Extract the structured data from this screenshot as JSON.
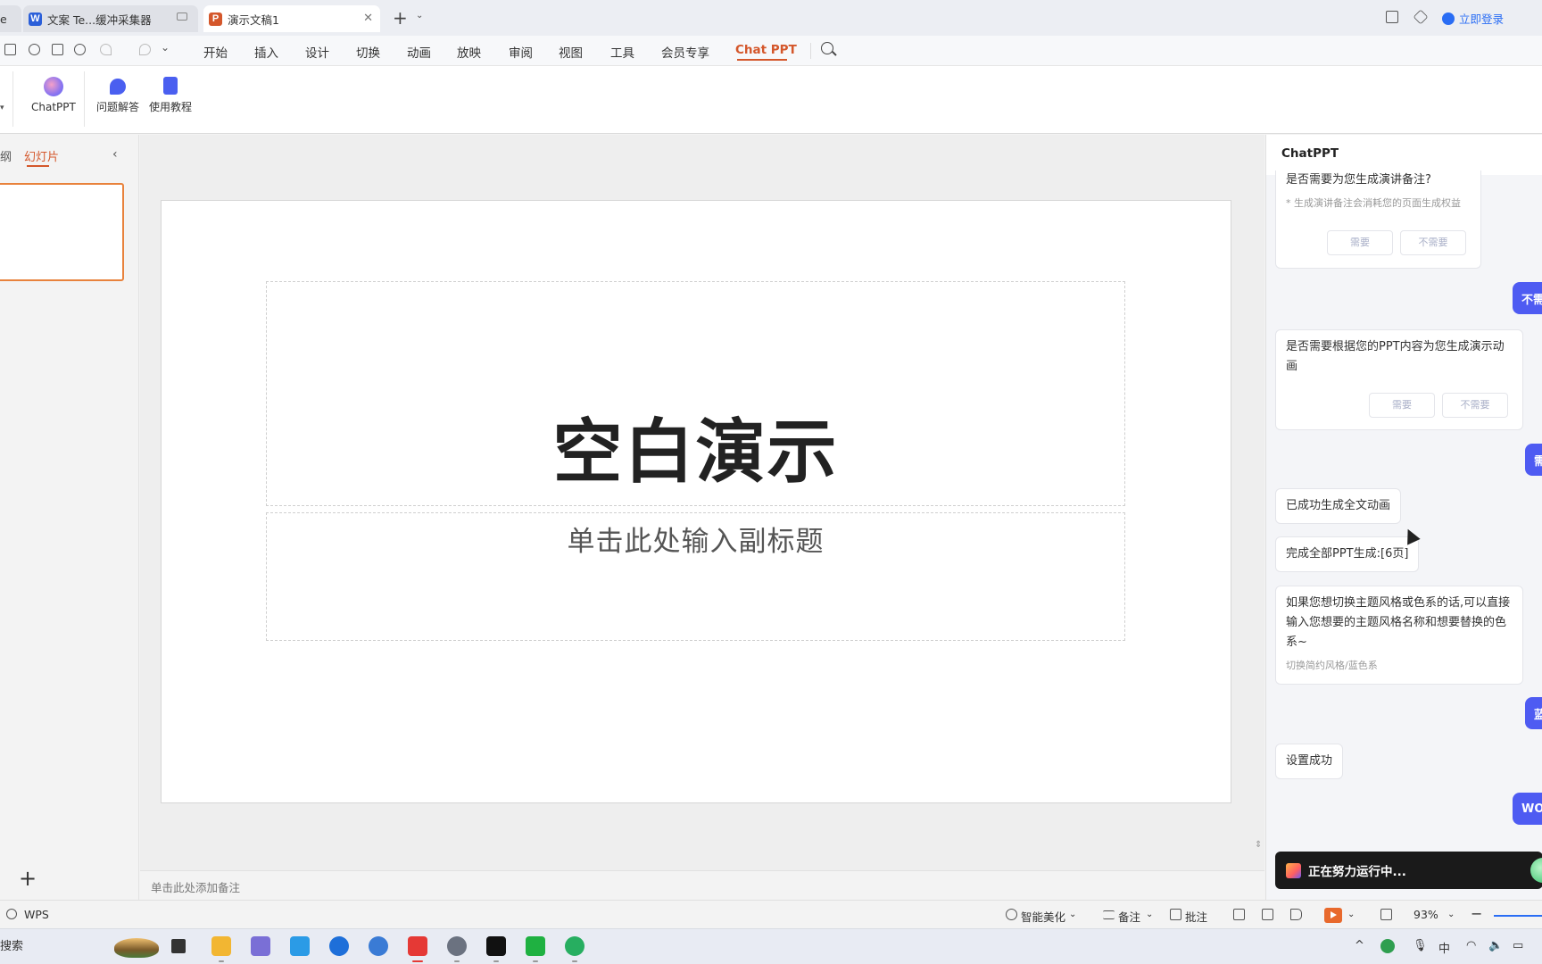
{
  "tabs": [
    {
      "label": "e",
      "state": "inactive"
    },
    {
      "label": "文案 Te...缓冲采集器",
      "icon": "W",
      "icon_color": "#2b5fd9",
      "state": "inactive"
    },
    {
      "label": "演示文稿1",
      "icon": "P",
      "icon_color": "#d4572b",
      "state": "active"
    }
  ],
  "login_label": "立即登录",
  "menu": [
    "开始",
    "插入",
    "设计",
    "切换",
    "动画",
    "放映",
    "审阅",
    "视图",
    "工具",
    "会员专享",
    "Chat PPT"
  ],
  "ribbon": {
    "chatppt": "ChatPPT",
    "qa": "问题解答",
    "tutorial": "使用教程"
  },
  "left_pane": {
    "outline_tab": "纲",
    "slides_tab": "幻灯片"
  },
  "slide": {
    "title": "空白演示",
    "subtitle": "单击此处输入副标题"
  },
  "notes_placeholder": "单击此处添加备注",
  "chat": {
    "title": "ChatPPT",
    "q1": "是否需要为您生成演讲备注?",
    "q1_hint": "* 生成演讲备注会消耗您的页面生成权益",
    "yes": "需要",
    "no": "不需要",
    "bubble1": "不需",
    "q2": "是否需要根据您的PPT内容为您生成演示动画",
    "bubble2": "需",
    "msg_anim": "已成功生成全文动画",
    "msg_done": "完成全部PPT生成:[6页]",
    "q3": "如果您想切换主题风格或色系的话,可以直接输入您想要的主题风格名称和想要替换的色系~",
    "q3_hint": "切换简约风格/蓝色系",
    "bubble3": "蓝",
    "msg_set": "设置成功",
    "bubble4": "WO",
    "running": "正在努力运行中..."
  },
  "status": {
    "app": "WPS",
    "beautify": "智能美化",
    "notes": "备注",
    "comments": "批注",
    "zoom": "93%"
  },
  "taskbar": {
    "search": "搜索",
    "ime": "中"
  },
  "colors": {
    "accent_orange": "#d4572b",
    "chat_blue": "#4e5bf2",
    "link_blue": "#2a6df4"
  }
}
